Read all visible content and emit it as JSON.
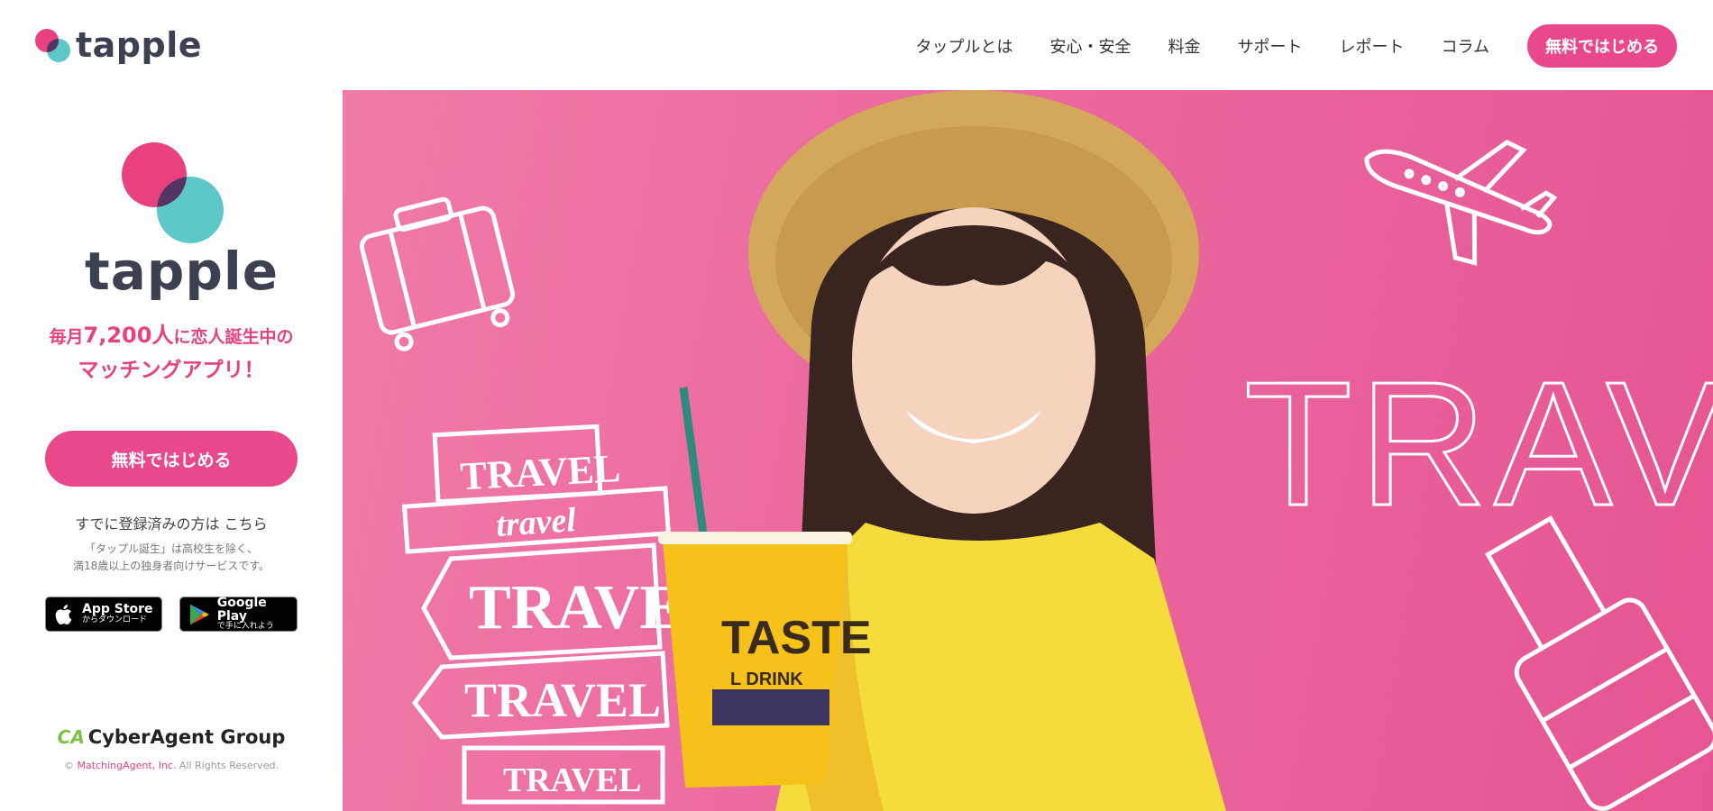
{
  "header": {
    "logo_text": "tapple",
    "nav": [
      {
        "label": "タップルとは"
      },
      {
        "label": "安心・安全"
      },
      {
        "label": "料金"
      },
      {
        "label": "サポート"
      },
      {
        "label": "レポート"
      },
      {
        "label": "コラム"
      }
    ],
    "cta_label": "無料ではじめる"
  },
  "sidebar": {
    "logo_text": "tapple",
    "tagline_prefix": "毎月",
    "tagline_number": "7,200人",
    "tagline_suffix": "に恋人誕生中の",
    "tagline_line2": "マッチングアプリ！",
    "cta_label": "無料ではじめる",
    "login_text": "すでに登録済みの方は",
    "login_link": "こちら",
    "notice_line1": "「タップル誕生」は高校生を除く、",
    "notice_line2": "満18歳以上の独身者向けサービスです。",
    "app_store": {
      "title": "App Store",
      "sub": "からダウンロード"
    },
    "google_play": {
      "title": "Google Play",
      "sub": "で手に入れよう"
    },
    "group_mark": "CA",
    "group_name": "CyberAgent Group",
    "copyright_symbol": "©",
    "copyright_company": "MatchingAgent, Inc.",
    "copyright_rights": "All Rights Reserved."
  },
  "hero": {
    "big_word": "TRAVEL",
    "signs": [
      "TRAVEL",
      "travel",
      "TRAVEL",
      "TRAVEL",
      "TRAVEL"
    ],
    "cup_text": "TASTE",
    "cup_sub": "L DRINK"
  },
  "colors": {
    "brand_pink": "#e9488a",
    "brand_teal": "#5ec8c8",
    "hero_bg": "#ec6a9f"
  }
}
